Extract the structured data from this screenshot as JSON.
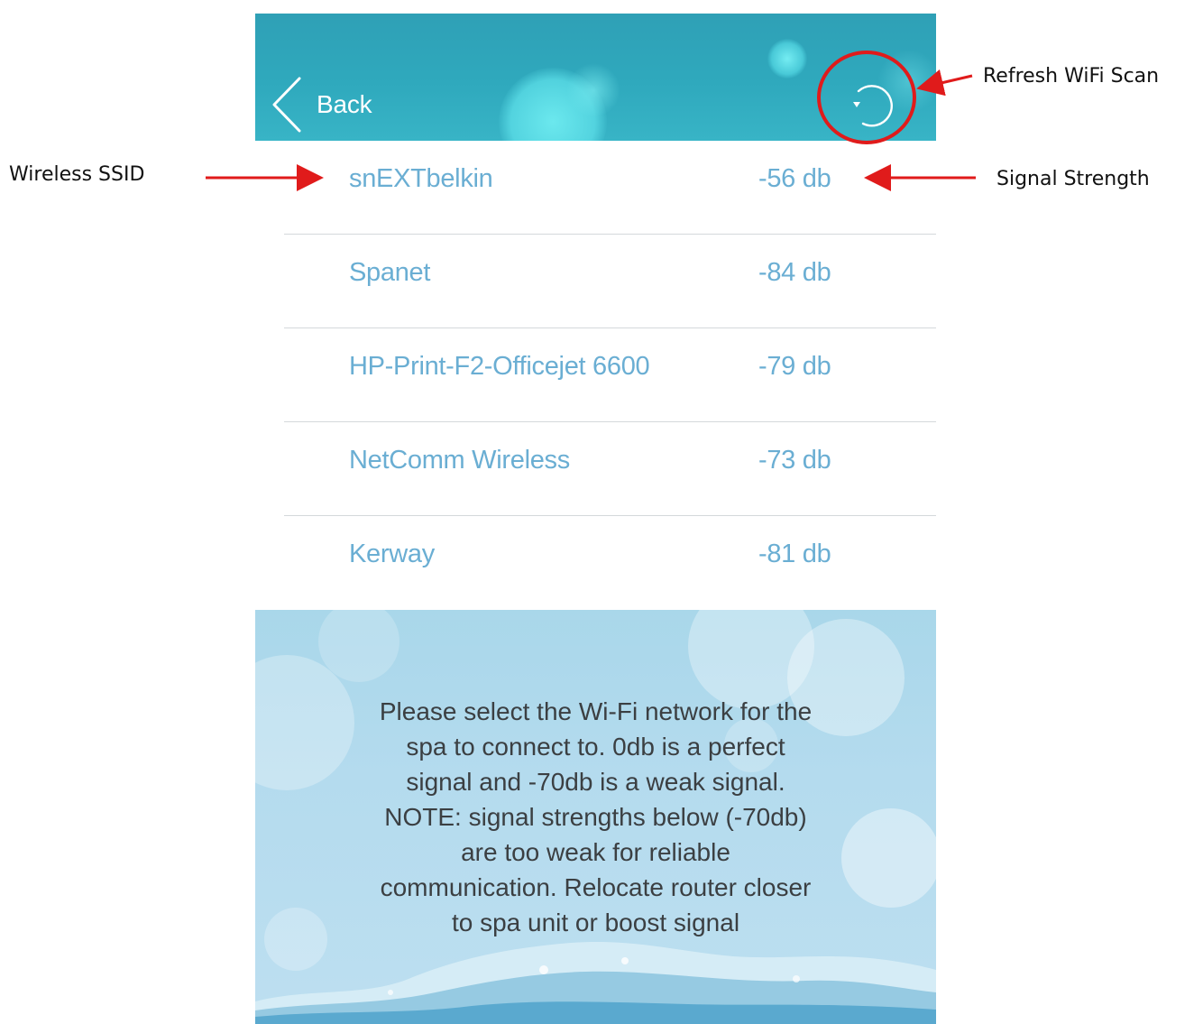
{
  "header": {
    "back_label": "Back",
    "back_icon": "chevron-left-icon",
    "refresh_icon": "refresh-icon",
    "colors": {
      "header_bg": "#2fa9bd",
      "text": "#ffffff"
    }
  },
  "networks": [
    {
      "ssid": "snEXTbelkin",
      "strength": "-56 db"
    },
    {
      "ssid": "Spanet",
      "strength": "-84 db"
    },
    {
      "ssid": "HP-Print-F2-Officejet 6600",
      "strength": "-79 db"
    },
    {
      "ssid": "NetComm Wireless",
      "strength": "-73 db"
    },
    {
      "ssid": "Kerway",
      "strength": "-81 db"
    }
  ],
  "info": {
    "lines": [
      "Please select the Wi-Fi network for the",
      "spa to connect to. 0db is a perfect",
      "signal and -70db is a weak signal.",
      "NOTE: signal strengths below (-70db)",
      "are too weak for reliable",
      "communication. Relocate router closer",
      "to spa unit or boost signal"
    ]
  },
  "annotations": {
    "refresh": "Refresh WiFi Scan",
    "ssid": "Wireless SSID",
    "signal": "Signal Strength",
    "arrow_color": "#e01b1b"
  },
  "colors": {
    "list_text": "#6aaed3",
    "separator": "#d4d8db",
    "info_text": "#3b3f42"
  }
}
